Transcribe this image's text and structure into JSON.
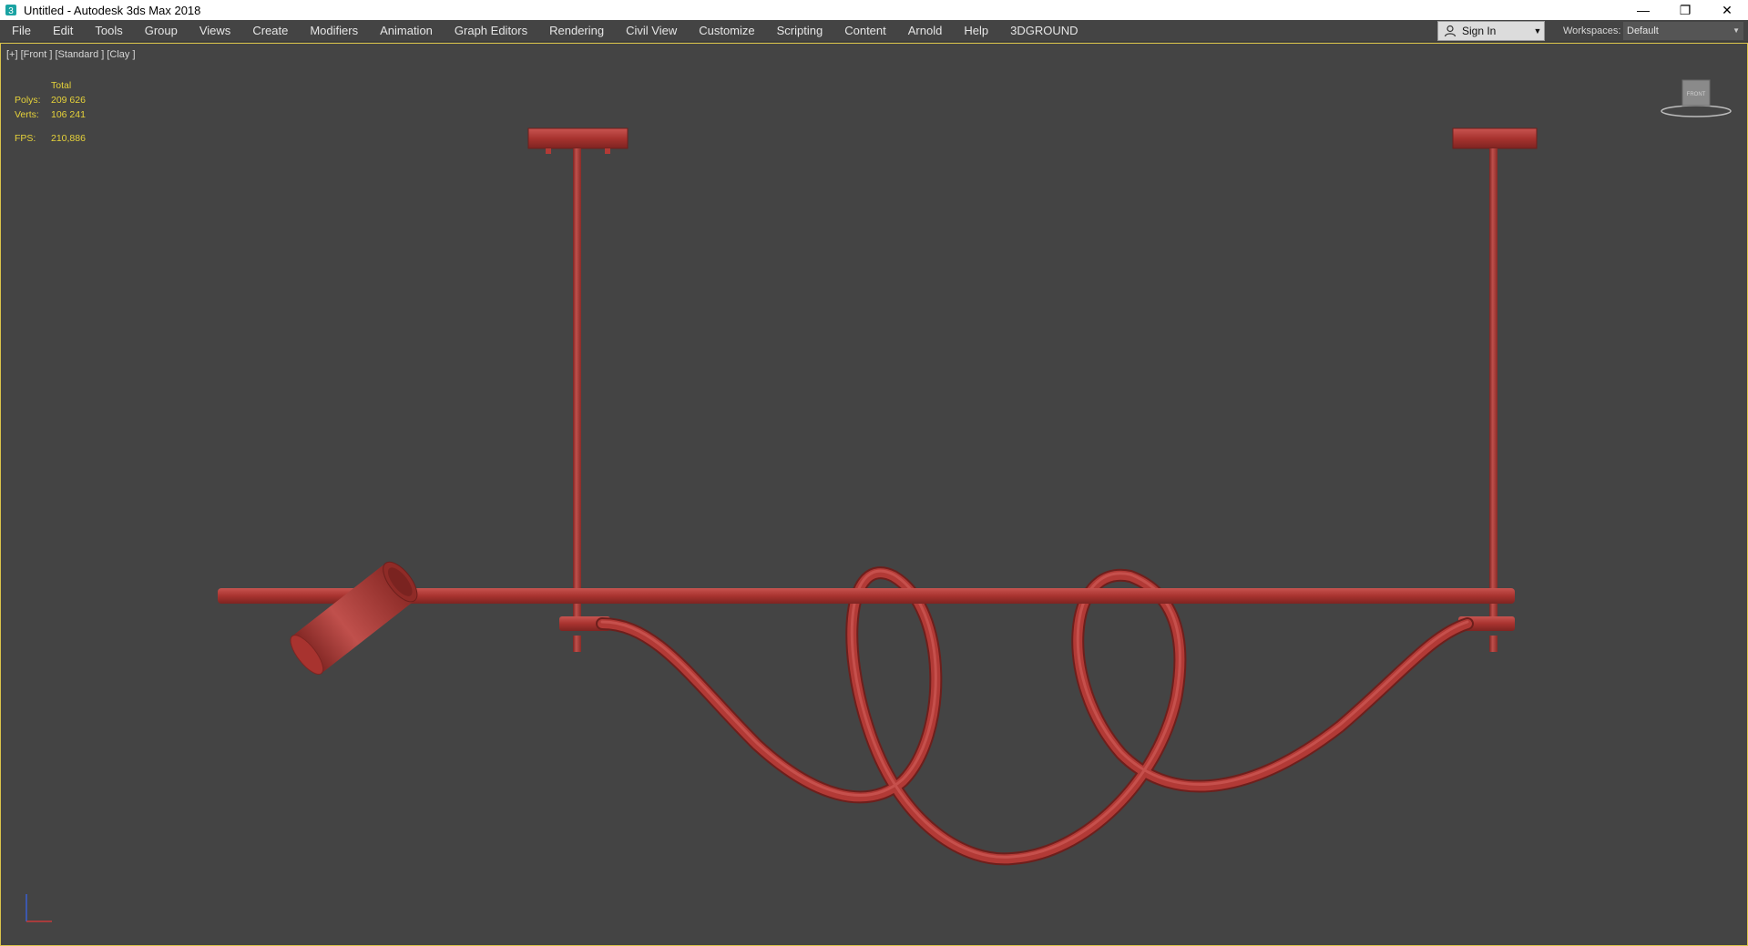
{
  "window": {
    "title": "Untitled - Autodesk 3ds Max 2018",
    "controls": {
      "minimize": "—",
      "restore": "❐",
      "close": "✕"
    }
  },
  "menu": {
    "items": [
      "File",
      "Edit",
      "Tools",
      "Group",
      "Views",
      "Create",
      "Modifiers",
      "Animation",
      "Graph Editors",
      "Rendering",
      "Civil View",
      "Customize",
      "Scripting",
      "Content",
      "Arnold",
      "Help",
      "3DGROUND"
    ],
    "sign_in": "Sign In",
    "workspaces_label": "Workspaces:",
    "workspace_value": "Default"
  },
  "viewport": {
    "label": "[+] [Front ] [Standard ] [Clay ]",
    "stats": {
      "header": "Total",
      "polys_label": "Polys:",
      "polys_value": "209 626",
      "verts_label": "Verts:",
      "verts_value": "106 241",
      "fps_label": "FPS:",
      "fps_value": "210,886"
    },
    "viewcube_label": "FRONT",
    "model_color": "#b23a36",
    "background_color": "#444444",
    "stats_color": "#e6d23a",
    "active_border_color": "#d9c24a"
  },
  "icons": {
    "app": "3dsmax-logo-icon",
    "user": "user-icon",
    "dropdown": "chevron-down-icon"
  }
}
